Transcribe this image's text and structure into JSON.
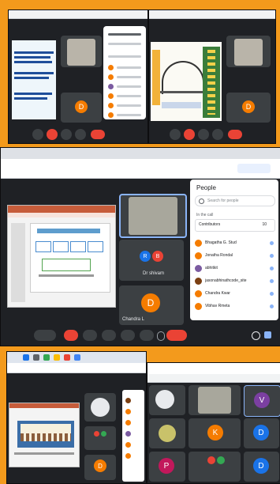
{
  "main": {
    "people_panel": {
      "title": "People",
      "search_placeholder": "Search for people",
      "section_label": "In the call",
      "group_label": "Contributors",
      "group_count": "10",
      "participants": [
        {
          "name": "Bhagatha G. Stud",
          "color": "#f57c00"
        },
        {
          "name": "Jonatha Rondal",
          "color": "#f57c00"
        },
        {
          "name": "abhitkit",
          "color": "#7b5ba1"
        },
        {
          "name": "jasonabhinathcode_site",
          "color": "#7b3f12"
        },
        {
          "name": "Chandra Kwar",
          "color": "#f57c00"
        },
        {
          "name": "Vibhav Rmeta",
          "color": "#f57c00"
        }
      ]
    },
    "tiles": [
      {
        "label": "Dr shivam"
      },
      {
        "label": "Chandra L"
      }
    ],
    "tile_avatar_letter": "D",
    "tile_avatar_pair": [
      "R",
      "B"
    ]
  },
  "bottom_right": {
    "avatars": [
      "V",
      "K",
      "D",
      "P",
      "D"
    ]
  },
  "top_left": {
    "avatar_letter": "D"
  },
  "top_right": {
    "avatar_letter": "D"
  },
  "bottom_left": {
    "avatar_letter": "D"
  },
  "colors": {
    "border": "#f39a1c",
    "meet_bg": "#1f2125",
    "tile_bg": "#3c4043",
    "avatar_orange": "#f57c00",
    "end_call": "#ea4335"
  }
}
